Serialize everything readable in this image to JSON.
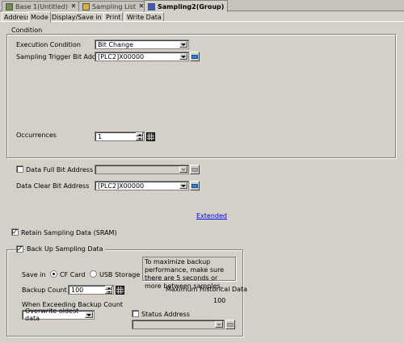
{
  "doc_tabs": [
    {
      "label": "Base 1(Untitled)",
      "icon": "screen-icon",
      "active": false
    },
    {
      "label": "Sampling List",
      "icon": "sampling-list-icon",
      "active": false
    },
    {
      "label": "Sampling2(Group)",
      "icon": "sampling-group-icon",
      "active": true
    }
  ],
  "inner_tabs": [
    "Address",
    "Mode",
    "Display/Save in CSV",
    "Print",
    "Write Data"
  ],
  "active_inner_tab": "Mode",
  "condition": {
    "title": "Condition",
    "execution_condition_label": "Execution Condition",
    "execution_condition_value": "Bit Change",
    "trigger_label": "Sampling Trigger Bit Address",
    "trigger_value": "[PLC2]X00000",
    "occurrences_label": "Occurrences",
    "occurrences_value": "1"
  },
  "data_full": {
    "label": "Data Full Bit Address",
    "checked": false,
    "value": ""
  },
  "data_clear": {
    "label": "Data Clear Bit Address",
    "value": "[PLC2]X00000"
  },
  "extended_link": "Extended",
  "retain": {
    "label": "Retain Sampling Data (SRAM)",
    "checked": true
  },
  "backup": {
    "label": "Back Up Sampling Data",
    "checked": true,
    "save_in_label": "Save in",
    "cf_card": "CF Card",
    "usb_storage": "USB Storage",
    "selected": "CF Card",
    "note": "To maximize backup performance, make sure there are 5 seconds or more between samples.",
    "backup_count_label": "Backup Count",
    "backup_count_value": "100",
    "max_hist_label": "Maximum Historical Data",
    "max_hist_value": "100",
    "exceeding_label": "When Exceeding Backup Count",
    "exceeding_value": "Overwrite oldest data",
    "status_label": "Status Address",
    "status_checked": false
  },
  "colors": {
    "face": "#d4d0c8",
    "link": "#0000ee",
    "keypad": "#2a7fd0"
  }
}
